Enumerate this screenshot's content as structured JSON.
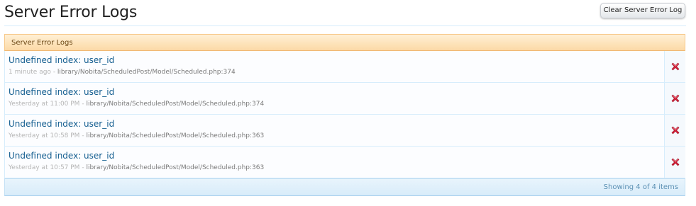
{
  "page": {
    "title": "Server Error Logs",
    "clear_button_label": "Clear Server Error Log"
  },
  "panel": {
    "header": "Server Error Logs",
    "footer": "Showing 4 of 4 items",
    "separator": "-",
    "rows": [
      {
        "title": "Undefined index: user_id",
        "time": "1 minute ago",
        "path": "library/Nobita/ScheduledPost/Model/Scheduled.php:374"
      },
      {
        "title": "Undefined index: user_id",
        "time": "Yesterday at 11:00 PM",
        "path": "library/Nobita/ScheduledPost/Model/Scheduled.php:374"
      },
      {
        "title": "Undefined index: user_id",
        "time": "Yesterday at 10:58 PM",
        "path": "library/Nobita/ScheduledPost/Model/Scheduled.php:363"
      },
      {
        "title": "Undefined index: user_id",
        "time": "Yesterday at 10:57 PM",
        "path": "library/Nobita/ScheduledPost/Model/Scheduled.php:363"
      }
    ]
  },
  "icons": {
    "delete": "delete-x-icon"
  },
  "colors": {
    "link": "#145e90",
    "header_bg": "#fcd9a6",
    "footer_bg": "#d8ecfa",
    "delete_red": "#d6223a"
  }
}
